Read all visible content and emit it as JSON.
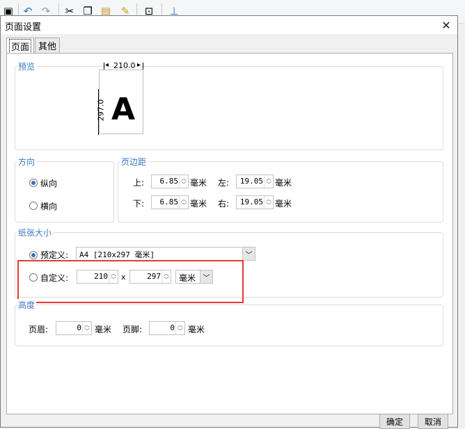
{
  "dialog": {
    "title": "页面设置"
  },
  "tabs": [
    {
      "label": "页面",
      "active": true
    },
    {
      "label": "其他",
      "active": false
    }
  ],
  "preview": {
    "group_label": "预览",
    "width_text": "210.0",
    "height_text": "297.0",
    "letter": "A"
  },
  "orientation": {
    "group_label": "方向",
    "portrait_label": "纵向",
    "landscape_label": "横向",
    "selected": "portrait"
  },
  "margins": {
    "group_label": "页边距",
    "top_label": "上:",
    "top_value": "6.85",
    "bottom_label": "下:",
    "bottom_value": "6.85",
    "left_label": "左:",
    "left_value": "19.05",
    "right_label": "右:",
    "right_value": "19.05",
    "unit": "毫米"
  },
  "paper": {
    "group_label": "纸张大小",
    "preset_label": "预定义:",
    "preset_value": "A4 [210x297 毫米]",
    "custom_label": "自定义:",
    "custom_width": "210",
    "times": "x",
    "custom_height": "297",
    "unit_value": "毫米",
    "selected": "preset"
  },
  "height": {
    "group_label": "高度",
    "header_label": "页眉:",
    "header_value": "0",
    "footer_label": "页脚:",
    "footer_value": "0",
    "unit": "毫米"
  },
  "buttons": {
    "ok": "确定",
    "cancel": "取消"
  },
  "colors": {
    "group_label": "#3b77c6",
    "highlight": "#e53935",
    "radio": "#2d73c6"
  }
}
